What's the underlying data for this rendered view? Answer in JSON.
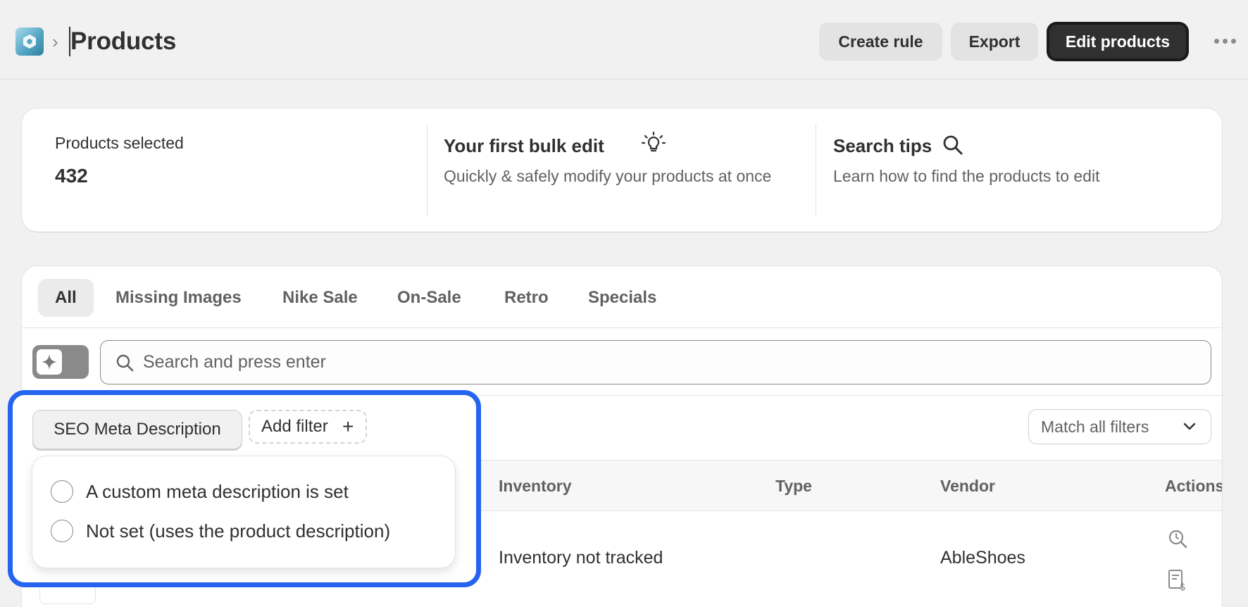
{
  "header": {
    "title": "Products",
    "breadcrumb_separator": "›",
    "buttons": {
      "create_rule": "Create rule",
      "export": "Export",
      "edit_products": "Edit products"
    }
  },
  "summary": {
    "selected_label": "Products selected",
    "selected_count": "432",
    "bulk_edit": {
      "title": "Your first bulk edit",
      "text": "Quickly & safely modify your products at once"
    },
    "search_tips": {
      "title": "Search tips",
      "text": "Learn how to find the products to edit"
    }
  },
  "tabs": [
    "All",
    "Missing Images",
    "Nike Sale",
    "On-Sale",
    "Retro",
    "Specials"
  ],
  "search": {
    "placeholder": "Search and press enter",
    "value": ""
  },
  "filters": {
    "active_filter": "SEO Meta Description",
    "add_filter_label": "Add filter",
    "add_filter_icon": "+",
    "match_label": "Match all filters",
    "options": [
      "A custom meta description is set",
      "Not set (uses the product description)"
    ]
  },
  "table": {
    "columns": [
      "Inventory",
      "Type",
      "Vendor",
      "Actions"
    ],
    "rows": [
      {
        "inventory": "Inventory not tracked",
        "type": "",
        "vendor": "AbleShoes"
      }
    ]
  },
  "colors": {
    "highlight_border": "#2563f0",
    "primary_button": "#303030",
    "logo_accent": "#55a6c4"
  },
  "icons": {
    "logo": "app-logo-icon",
    "bulk_edit": "lightbulb-icon",
    "search_tips": "magnifier-icon",
    "search": "search-icon",
    "ai_toggle": "sparkle-icon",
    "match": "chevron-down-icon",
    "row_actions": [
      "history-search-icon",
      "price-list-icon"
    ],
    "more": "ellipsis-icon"
  }
}
